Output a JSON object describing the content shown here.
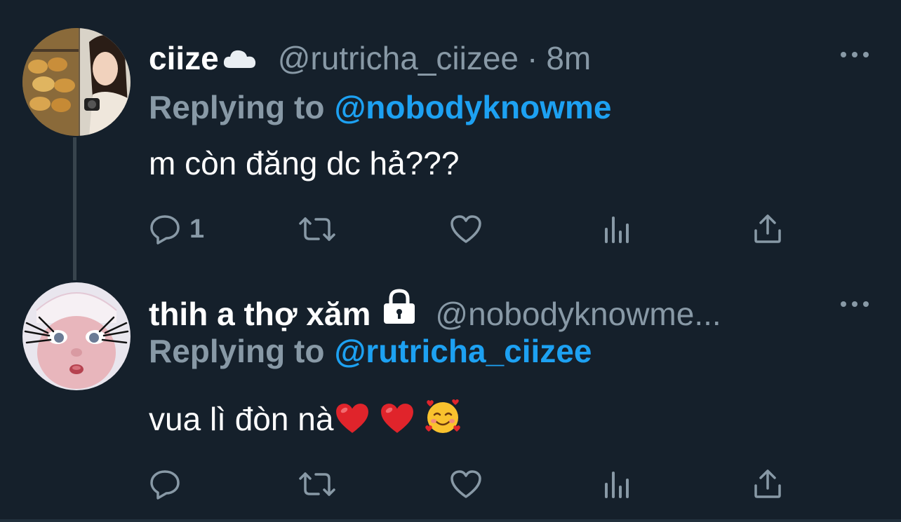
{
  "tweets": [
    {
      "display_name": "ciize",
      "name_icon": "cloud-icon",
      "handle": "@rutricha_ciizee",
      "separator": "·",
      "time": "8m",
      "replying_prefix": "Replying to",
      "replying_to": "@nobodyknowme",
      "text": "m còn đăng dc hả???",
      "reply_count": "1",
      "avatar": "bakery-photo-avatar"
    },
    {
      "display_name": "thih a thợ xăm",
      "name_icon": "lock-icon",
      "handle": "@nobodyknowme...",
      "replying_prefix": "Replying to",
      "replying_to": "@rutricha_ciizee",
      "text": "vua lì đòn nà",
      "emojis": [
        "red-heart-emoji",
        "red-heart-emoji",
        "smiling-face-with-hearts-emoji"
      ],
      "reply_count": "",
      "avatar": "doll-face-avatar"
    }
  ],
  "colors": {
    "background": "#15202b",
    "secondary_text": "#8899a6",
    "accent": "#1da1f2",
    "primary_text": "#ffffff"
  }
}
